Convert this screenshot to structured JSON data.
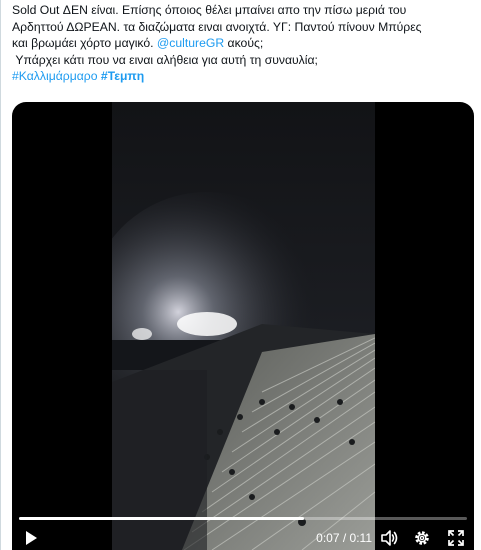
{
  "tweet": {
    "line1": "Sold Out ΔΕΝ είναι. Επίσης όποιος θέλει μπαίνει απο την πίσω μεριά του",
    "line2": "Αρδηττού ΔΩΡΕΑΝ. τα διαζώματα ειναι ανοιχτά. ΥΓ: Παντού πίνουν Μπύρες",
    "line3_pre": "και βρωμάει χόρτο μαγικό.",
    "mention": "@cultureGR",
    "line3_post": "ακούς;",
    "line4": "Υπάρχει κάτι που να ειναι αλήθεια για αυτή τη συναυλία;",
    "hashtag1": "#Καλλιμάρμαρο",
    "hashtag2": "#Τεμπη"
  },
  "video": {
    "current_time": "0:07",
    "duration": "0:11",
    "time_separator": " / ",
    "progress_fraction": 0.636
  },
  "icons": {
    "play": "play-icon",
    "volume": "volume-icon",
    "settings": "gear-icon",
    "fullscreen": "fullscreen-icon"
  },
  "colors": {
    "link": "#1d9bf0",
    "text": "#0f1419",
    "video_bg": "#000000"
  }
}
